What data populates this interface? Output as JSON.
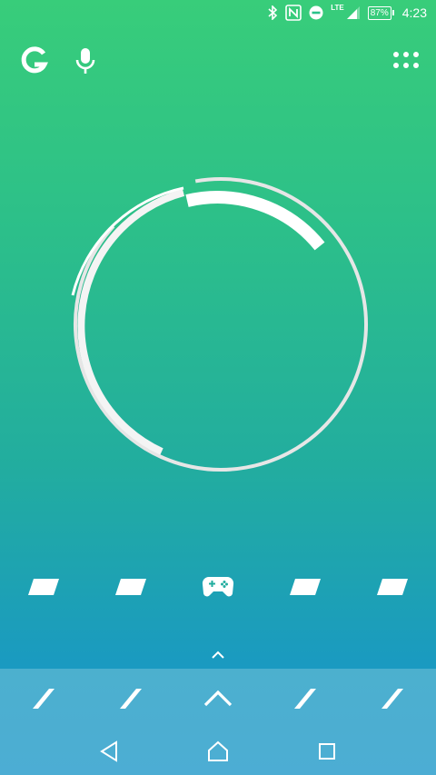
{
  "status_bar": {
    "icons": [
      "bluetooth-icon",
      "nfc-icon",
      "do-not-disturb-icon",
      "lte-signal-icon",
      "battery-icon"
    ],
    "network_label": "LTE",
    "battery_percent": "87%",
    "time": "4:23"
  },
  "search_bar": {
    "google_icon": "google-g-icon",
    "voice_icon": "microphone-icon",
    "menu_icon": "app-grid-icon"
  },
  "clock_widget": {
    "type": "circular-analog-clock",
    "outer_ring_color": "#e8e8e8",
    "hand_color": "#ffffff"
  },
  "home_row": {
    "apps": [
      {
        "icon": "slash-placeholder-icon"
      },
      {
        "icon": "slash-placeholder-icon"
      },
      {
        "icon": "game-controller-icon"
      },
      {
        "icon": "slash-placeholder-icon"
      },
      {
        "icon": "slash-placeholder-icon"
      }
    ]
  },
  "drawer_handle_icon": "chevron-up-icon",
  "dock": {
    "apps": [
      {
        "icon": "slash-placeholder-icon"
      },
      {
        "icon": "slash-placeholder-icon"
      },
      {
        "icon": "chevron-up-icon"
      },
      {
        "icon": "slash-placeholder-icon"
      },
      {
        "icon": "slash-placeholder-icon"
      }
    ]
  },
  "nav_bar": {
    "buttons": [
      "back-icon",
      "home-icon",
      "recents-icon"
    ]
  },
  "colors": {
    "gradient_top": "#38cd7a",
    "gradient_bottom": "#1a97c8",
    "foreground": "#ffffff"
  }
}
